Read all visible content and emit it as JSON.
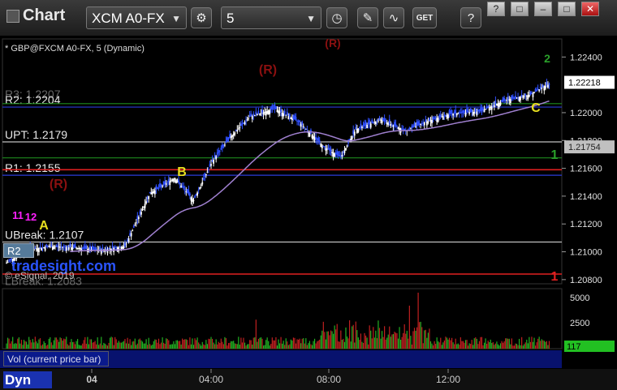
{
  "toolbar": {
    "title": "Chart",
    "symbol": "XCM A0-FX",
    "interval": "5",
    "icons": [
      "gear-icon",
      "clock-icon",
      "pencil-icon",
      "study-icon",
      "get-icon",
      "help-icon"
    ],
    "window_buttons": [
      "?",
      "□",
      "–",
      "✕"
    ]
  },
  "chart_header": {
    "symbol_label": "* GBP@FXCM A0-FX, 5 (Dynamic)"
  },
  "watermark": "tradesight.com",
  "copyright": "© eSignal, 2019",
  "vol_label": "Vol (current price bar)",
  "dyn_button": "Dyn",
  "r_box_label": "R2",
  "chart_data": {
    "type": "candlestick",
    "y_axis": {
      "ticks": [
        "1.22400",
        "1.22000",
        "1.21800",
        "1.21600",
        "1.21400",
        "1.21200",
        "1.21000",
        "1.20800"
      ],
      "range": [
        1.2077,
        1.2253
      ]
    },
    "x_axis": {
      "ticks": [
        "04",
        "04:00",
        "08:00",
        "12:00"
      ]
    },
    "last_price_tag": "1.22218",
    "ma_tag": "1.21754",
    "volume_axis": {
      "ticks": [
        "5000",
        "2500"
      ],
      "last_tag": "117"
    },
    "levels": [
      {
        "label": "R2: 1.2204",
        "value": 1.2204,
        "color": "#2a3bd8"
      },
      {
        "label": "UPT: 1.2179",
        "value": 1.2179,
        "color": "#c0c0c0"
      },
      {
        "label": "R1: 1.2155",
        "value": 1.2155,
        "color": "#2a3bd8"
      },
      {
        "label": "UBreak: 1.2107",
        "value": 1.2107,
        "color": "#c0c0c0"
      },
      {
        "label": "",
        "value": 1.2084,
        "color": "#e02020"
      },
      {
        "label": "",
        "value": 1.2159,
        "color": "#e02020"
      },
      {
        "label": "",
        "value": 1.21675,
        "color": "#1e8a1e"
      },
      {
        "label": "",
        "value": 1.22065,
        "color": "#1e8a1e"
      }
    ],
    "overlapped_labels": [
      "R3: 1.2207",
      "LBreak: 1.2083"
    ],
    "annotations": [
      {
        "text": "(R)",
        "color": "#8b1010"
      },
      {
        "text": "(R)",
        "color": "#8b1010"
      },
      {
        "text": "(R)",
        "color": "#8b1010"
      },
      {
        "text": "A",
        "color": "#e8e020"
      },
      {
        "text": "B",
        "color": "#e8e020"
      },
      {
        "text": "C",
        "color": "#e8e020"
      },
      {
        "text": "2",
        "color": "#2aa02a"
      },
      {
        "text": "1",
        "color": "#2aa02a"
      },
      {
        "text": "1",
        "color": "#e02020"
      },
      {
        "text": "11",
        "color": "#ff20ff"
      },
      {
        "text": "12",
        "color": "#ff20ff"
      }
    ]
  }
}
